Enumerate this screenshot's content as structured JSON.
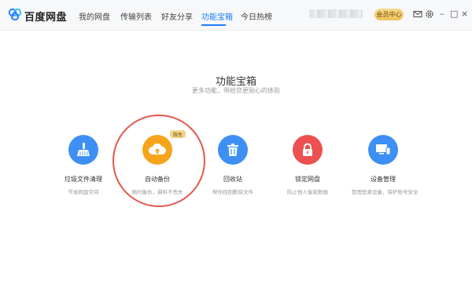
{
  "app": {
    "title": "百度网盘"
  },
  "nav": {
    "items": [
      {
        "label": "我的网盘"
      },
      {
        "label": "传输列表"
      },
      {
        "label": "好友分享"
      },
      {
        "label": "功能宝箱"
      },
      {
        "label": "今日热榜"
      }
    ],
    "active_index": 3
  },
  "toolbar": {
    "vip_label": "会员中心"
  },
  "window_controls": {
    "minimize": "–",
    "maximize": "□",
    "close": "×"
  },
  "main": {
    "title": "功能宝箱",
    "subtitle": "更多功能，带给您更贴心的体验",
    "features": [
      {
        "name": "垃圾文件清理",
        "desc": "节省网盘空间",
        "color": "#3d8ff3",
        "icon": "broom-icon"
      },
      {
        "name": "自动备份",
        "desc": "随时备份，資料不丢失",
        "color": "#f6a41a",
        "icon": "cloud-upload-icon",
        "badge": "限免"
      },
      {
        "name": "回收站",
        "desc": "帮你找回删除文件",
        "color": "#3d8ff3",
        "icon": "trash-icon"
      },
      {
        "name": "锁定网盘",
        "desc": "防止他人偷窥数据",
        "color": "#ec5050",
        "icon": "lock-icon"
      },
      {
        "name": "设备管理",
        "desc": "管理登录设备，保护账号安全",
        "color": "#3d8ff3",
        "icon": "devices-icon"
      }
    ]
  },
  "colors": {
    "accent": "#1e7bf6",
    "highlight_ring": "#e05a4e"
  }
}
